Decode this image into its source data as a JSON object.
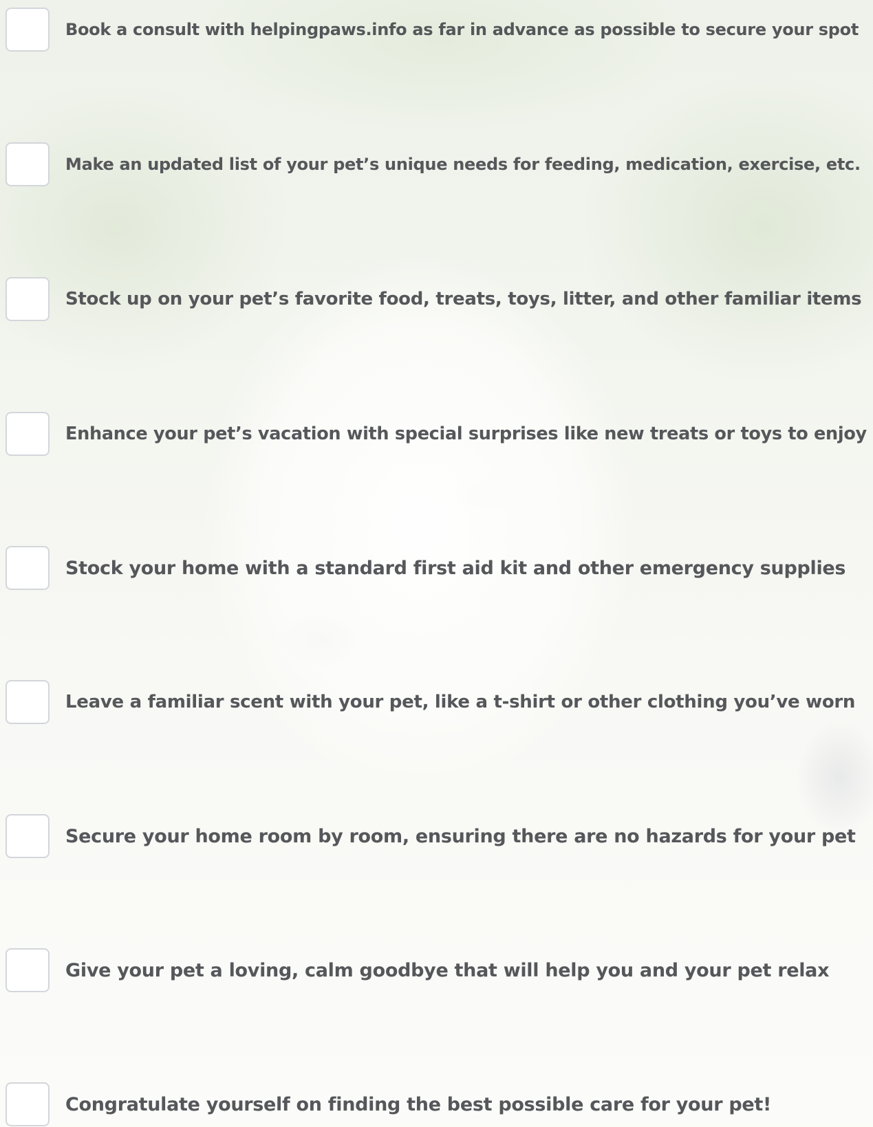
{
  "checklist": {
    "items": [
      {
        "label": "Book a consult with helpingpaws.info as far in advance as possible to secure your spot",
        "checked": false
      },
      {
        "label": "Make an updated list of your pet’s unique needs for feeding, medication, exercise, etc.",
        "checked": false
      },
      {
        "label": "Stock up on your pet’s favorite food, treats, toys, litter, and other familiar items",
        "checked": false
      },
      {
        "label": "Enhance your pet’s vacation with special surprises like new treats or toys to enjoy",
        "checked": false
      },
      {
        "label": "Stock your home with a standard first aid kit and other emergency supplies",
        "checked": false
      },
      {
        "label": "Leave a familiar scent with your pet, like a t-shirt or other clothing you’ve worn",
        "checked": false
      },
      {
        "label": "Secure your home room by room, ensuring there are no hazards for your pet",
        "checked": false
      },
      {
        "label": "Give your pet a loving, calm goodbye that will help you and your pet relax",
        "checked": false
      },
      {
        "label": "Congratulate yourself on finding the best possible care for your pet!",
        "checked": false
      }
    ]
  }
}
